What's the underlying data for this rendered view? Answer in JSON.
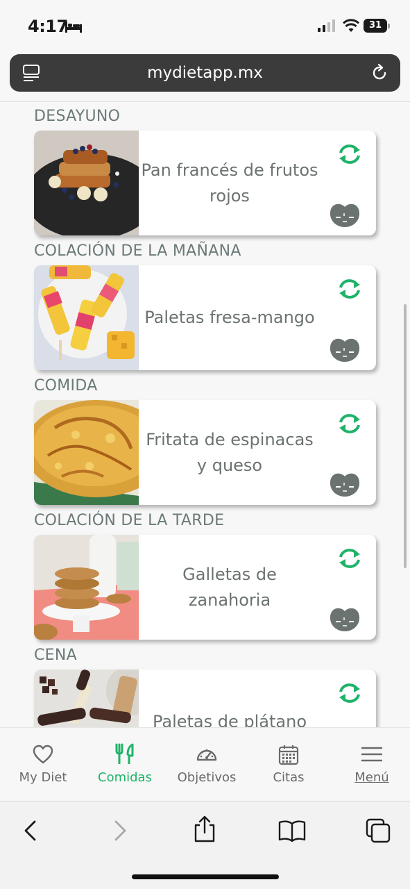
{
  "status_bar": {
    "time": "4:17",
    "battery": "31"
  },
  "browser": {
    "url": "mydietapp.mx"
  },
  "meals": [
    {
      "heading": "DESAYUNO",
      "name": "Pan francés de frutos rojos"
    },
    {
      "heading": "COLACIÓN DE LA MAÑANA",
      "name": "Paletas fresa-mango"
    },
    {
      "heading": "COMIDA",
      "name": "Fritata de espinacas y queso"
    },
    {
      "heading": "COLACIÓN DE LA TARDE",
      "name": "Galletas de zanahoria"
    },
    {
      "heading": "CENA",
      "name": "Paletas de plátano"
    }
  ],
  "tabs": [
    {
      "label": "My Diet",
      "icon": "heart-icon"
    },
    {
      "label": "Comidas",
      "icon": "fork-knife-icon",
      "active": true
    },
    {
      "label": "Objetivos",
      "icon": "gauge-icon"
    },
    {
      "label": "Citas",
      "icon": "calendar-icon"
    },
    {
      "label": "Menú",
      "icon": "hamburger-icon"
    }
  ],
  "colors": {
    "accent": "#1fb369",
    "text_muted": "#6b7370",
    "face_icon": "#6b7370"
  }
}
